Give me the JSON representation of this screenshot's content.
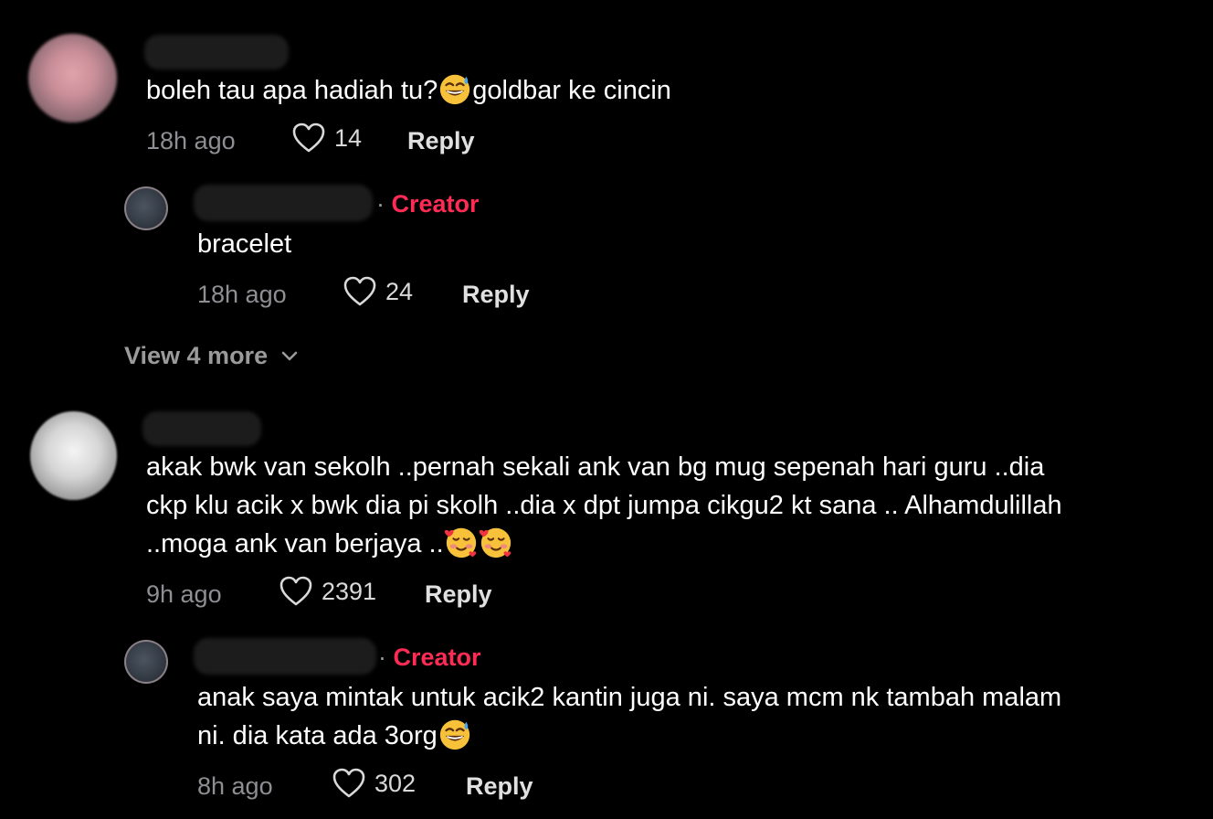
{
  "colors": {
    "background": "#000000",
    "creator_accent": "#fe2c55",
    "muted_text": "#8e8e93"
  },
  "comments": [
    {
      "text": "boleh tau apa hadiah tu?",
      "text_after_emoji": "goldbar ke cincin",
      "emoji": "grinning-sweat-emoji",
      "time": "18h ago",
      "likes": "14",
      "reply_label": "Reply",
      "replies": [
        {
          "creator_label": "Creator",
          "text": "bracelet",
          "time": "18h ago",
          "likes": "24",
          "reply_label": "Reply"
        }
      ],
      "view_more_label": "View 4 more"
    },
    {
      "text_lines": [
        "akak bwk van sekolh ..pernah sekali ank van bg mug sepenah hari guru ..dia",
        "ckp klu acik x bwk dia pi skolh ..dia x dpt jumpa cikgu2 kt sana .. Alhamdulillah",
        "..moga ank van berjaya .."
      ],
      "emoji": "smiling-hearts-emoji",
      "time": "9h ago",
      "likes": "2391",
      "reply_label": "Reply",
      "replies": [
        {
          "creator_label": "Creator",
          "text_lines": [
            "anak saya mintak untuk acik2 kantin juga ni. saya mcm nk tambah malam",
            "ni. dia kata ada 3org"
          ],
          "emoji": "grinning-sweat-emoji",
          "time": "8h ago",
          "likes": "302",
          "reply_label": "Reply"
        }
      ]
    }
  ]
}
